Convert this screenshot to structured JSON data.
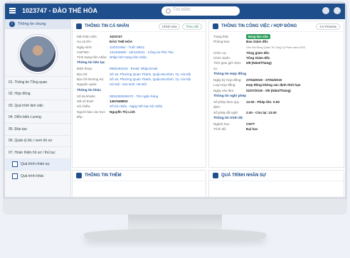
{
  "header": {
    "title": "1023747 - ĐÀO THẾ HÒA",
    "search_placeholder": "Tìm kiếm"
  },
  "sidebar": {
    "info_label": "Thông tin chung",
    "items": [
      {
        "label": "01. Thông tin Tổng quan"
      },
      {
        "label": "02. Hợp đồng"
      },
      {
        "label": "03. Quá trình làm việc"
      },
      {
        "label": "04. Diễn biến Lương"
      },
      {
        "label": "05. Đào tạo"
      },
      {
        "label": "06. Quản lý tốc / xem hồ sơ"
      },
      {
        "label": "07. Hoàn thiện hồ sơ / thủ tục"
      },
      {
        "label": "Quá trình nhân sự"
      },
      {
        "label": "Quá trình khác"
      }
    ]
  },
  "personal": {
    "title": "THÔNG TIN CÁ NHÂN",
    "edit_btn": "Chỉnh sửa",
    "follow_btn": "Theo dõi",
    "rows": [
      {
        "k": "Mã nhân viên:",
        "v": "1023747"
      },
      {
        "k": "Họ và tên:",
        "v": "ĐÀO THẾ HÒA"
      },
      {
        "k": "Ngày sinh:",
        "v": "11/01/1962 - Tuổi: 58/11"
      },
      {
        "k": "CMTND:",
        "v": "131402508 - 16/12/2011 - Công an Phú Thọ"
      },
      {
        "k": "Tình trạng hôn nhân:",
        "v": "Nhập tình trạng hôn nhân"
      }
    ],
    "section_contact": "Thông tin liên lạc",
    "contact_rows": [
      {
        "k": "Điện thoại:",
        "v": "0982192219 - Email: Nhập Email"
      },
      {
        "k": "Địa chỉ:",
        "v": "Số 16, Phường Quán Thánh, Quận Ba Đình, Tp. Hà Nội"
      },
      {
        "k": "Địa chỉ thường trú:",
        "v": "Số 16, Phường Quán Thánh, Quận Ba Đình, Tp. Hà Nội"
      },
      {
        "k": "Nguyên quán:",
        "v": "Hà Nội - Nơi sinh: Hà Nội"
      }
    ],
    "section_other": "Thông tin khác",
    "other_rows": [
      {
        "k": "Số tài khoản:",
        "v": "0831000028470 - Tên ngân hàng"
      },
      {
        "k": "Mã số thuế:",
        "v": "1457648903"
      },
      {
        "k": "Hộ chiếu:",
        "v": "Số hộ chiếu - Ngày hết hạn hộ chiếu"
      },
      {
        "k": "Người báo cáo trực tiếp:",
        "v": "Nguyễn Thị Linh"
      }
    ]
  },
  "work": {
    "title": "THÔNG TIN CÔNG VIỆC / HỢP ĐỒNG",
    "preview_btn": "CV Preview",
    "rows": [
      {
        "k": "Trạng thái:",
        "v": "Đang làm việc"
      },
      {
        "k": "Phòng ban:",
        "v": "Ban Giám đốc",
        "sub": "Văn Hội Đồng Quản Trị Công Ty Phần mềm DGS"
      },
      {
        "k": "Chức vụ:",
        "v": "Tổng giám đốc"
      },
      {
        "k": "Chức danh:",
        "v": "Tổng Giám đốc"
      },
      {
        "k": "Thời gian giữ chức vụ:",
        "v": "0/8 (Năm/Tháng)"
      }
    ],
    "section_contract": "Thông tin Hợp đồng",
    "contract_rows": [
      {
        "k": "Ngày ký Hợp đồng:",
        "v": "27/04/2019 - 27/04/2019"
      },
      {
        "k": "Loại Hợp đồng:",
        "v": "Hợp đồng không xác định thời hạn"
      },
      {
        "k": "Ngày vào làm:",
        "v": "01/07/2019 - 0/5 (Năm/Tháng)"
      }
    ],
    "section_leave": "Thông tin nghỉ phép",
    "leave_rows": [
      {
        "k": "Số phép theo quy định:",
        "v": "13.00 - Phép tồn: 0.00"
      },
      {
        "k": "Số phép đã nghỉ:",
        "v": "2.00 - Còn lại: 13.00"
      }
    ],
    "section_edu": "Thông tin trình độ",
    "edu_rows": [
      {
        "k": "Ngành học:",
        "v": "CNTT"
      },
      {
        "k": "Trình độ:",
        "v": "Đại học"
      }
    ]
  },
  "bottom": {
    "left_title": "THÔNG TIN THÊM",
    "right_title": "QUÁ TRÌNH NHÂN SỰ"
  }
}
